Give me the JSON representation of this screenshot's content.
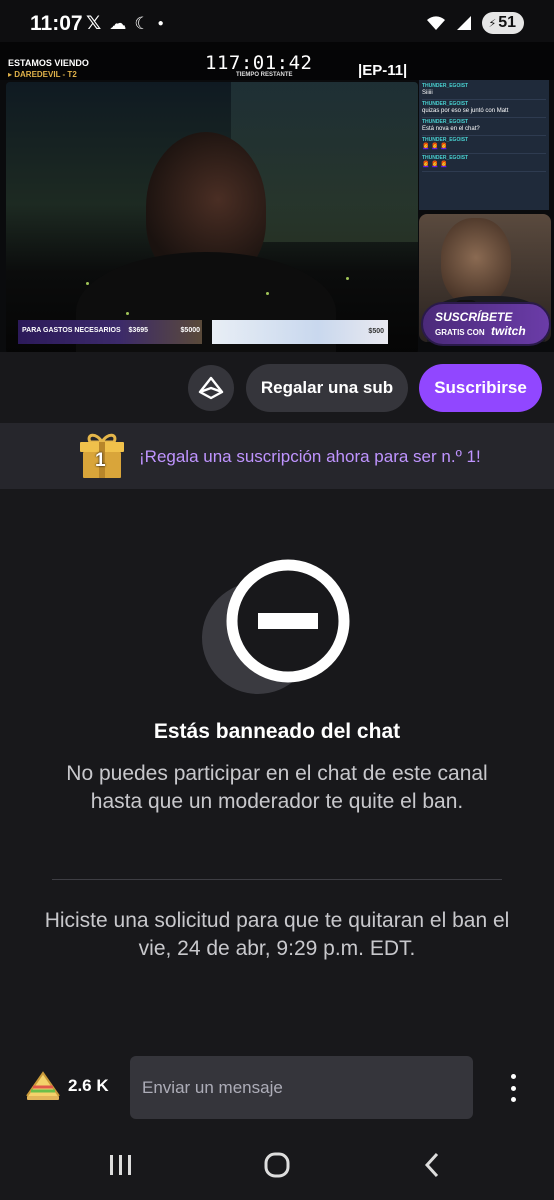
{
  "status_bar": {
    "time": "11:07",
    "battery": "51",
    "left_icons": [
      "x-logo-icon",
      "cloud-icon",
      "moon-icon",
      "dot-icon"
    ],
    "right_icons": [
      "wifi-icon",
      "signal-icon",
      "battery-icon"
    ]
  },
  "video": {
    "watching_label": "ESTAMOS VIENDO",
    "watching_show": "▸ DAREDEVIL - T2",
    "timer": "117:01:42",
    "timer_label": "TIEMPO RESTANTE",
    "episode": "|EP-11|",
    "chat_overlay": [
      {
        "user": "THUNDER_EGOIST",
        "text": "Siiiii"
      },
      {
        "user": "THUNDER_EGOIST",
        "text": "quizas por eso se juntó con Matt"
      },
      {
        "user": "THUNDER_EGOIST",
        "text": "Está nova en el chat?"
      },
      {
        "user": "THUNDER_EGOIST",
        "text": "👩‍🦰 👩‍🦰 👩‍🦰"
      },
      {
        "user": "THUNDER_EGOIST",
        "text": "👩‍🦰 👩‍🦰 👩‍🦰"
      }
    ],
    "sub_badge_title": "SUSCRÍBETE",
    "sub_badge_line": "GRATIS CON",
    "sub_badge_brand": "twitch",
    "banner_left_text": "PARA GASTOS NECESARIOS",
    "banner_left_amount_a": "$3695",
    "banner_left_amount_b": "$5000",
    "banner_right_text": "",
    "banner_right_amount": "$500"
  },
  "actions": {
    "prime_icon": "prime-crown-icon",
    "gift_label": "Regalar una sub",
    "subscribe_label": "Suscribirse",
    "subscribe_color": "#9147ff"
  },
  "promo": {
    "gift_rank": "1",
    "text": "¡Regala una suscripción ahora para ser n.º 1!",
    "text_color": "#bf94ff"
  },
  "ban": {
    "icon": "ban-icon",
    "title": "Estás banneado del chat",
    "description": "No puedes participar en el chat de este canal hasta que un moderador te quite el ban.",
    "request": "Hiciste una solicitud para que te quitaran el ban el vie, 24 de abr, 9:29 p.m. EDT."
  },
  "chat": {
    "viewer_icon": "sandwich-icon",
    "viewer_count": "2.6 K",
    "placeholder": "Enviar un mensaje",
    "more_icon": "more-vertical-icon"
  },
  "nav": {
    "recents_icon": "recents-icon",
    "home_icon": "home-icon",
    "back_icon": "back-icon"
  }
}
